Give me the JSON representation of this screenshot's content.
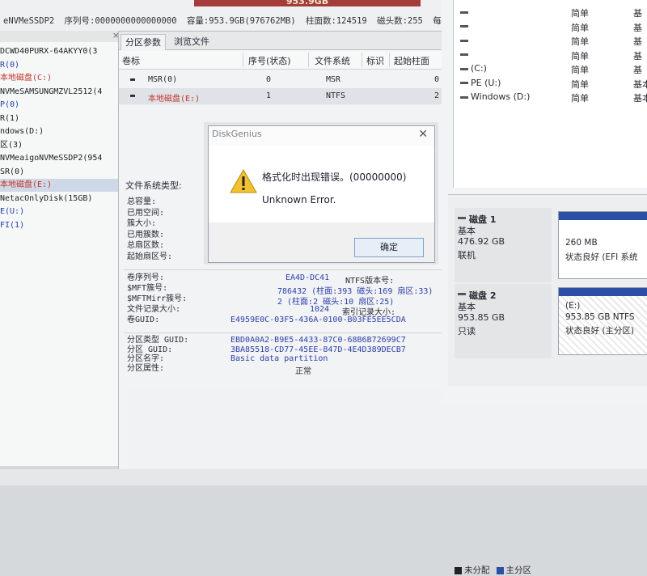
{
  "topbar": {
    "capacity_bar_text": "953.9GB",
    "disk_info": {
      "model": "eNVMeSSDP2",
      "serial_label": "序列号:",
      "serial_value": "0000000000000000",
      "capacity_label": "容量:",
      "capacity_value": "953.9GB(976762MB)",
      "cylinders_label": "柱面数:",
      "cylinders_value": "124519",
      "heads_label": "磁头数:",
      "heads_value": "255",
      "sectors_label": "每"
    }
  },
  "tree": {
    "close_glyph": "×",
    "items": [
      {
        "text": "DCWD40PURX-64AKYY0(3",
        "color": "#1d1d1d"
      },
      {
        "text": "R(0)",
        "color": "#1f3fb5"
      },
      {
        "text": "本地磁盘(C:)",
        "color": "#c2362b"
      },
      {
        "text": "NVMeSAMSUNGMZVL2512(4",
        "color": "#1d1d1d"
      },
      {
        "text": "P(0)",
        "color": "#1f3fb5"
      },
      {
        "text": "R(1)",
        "color": "#1d1d1d"
      },
      {
        "text": "ndows(D:)",
        "color": "#1d1d1d"
      },
      {
        "text": "区(3)",
        "color": "#1d1d1d"
      },
      {
        "text": "NVMeaigoNVMeSSDP2(954",
        "color": "#1d1d1d"
      },
      {
        "text": "SR(0)",
        "color": "#1d1d1d"
      },
      {
        "text": "本地磁盘(E:)",
        "color": "#c2362b"
      },
      {
        "text": "NetacOnlyDisk(15GB)",
        "color": "#1d1d1d"
      },
      {
        "text": "E(U:)",
        "color": "#1f3fb5"
      },
      {
        "text": "FI(1)",
        "color": "#1f3fb5"
      }
    ]
  },
  "mid": {
    "tabs": [
      "分区参数",
      "浏览文件"
    ],
    "columns": [
      "卷标",
      "序号(状态)",
      "文件系统",
      "标识",
      "起始柱面"
    ],
    "rows": [
      {
        "label": "MSR(0)",
        "index": "0",
        "fs": "MSR",
        "id": "",
        "start": "0"
      },
      {
        "label": "本地磁盘(E:)",
        "index": "1",
        "fs": "NTFS",
        "id": "",
        "start": "2"
      }
    ],
    "fs_title": "文件系统类型:",
    "fs_labels": [
      "总容量:",
      "已用空间:",
      "簇大小:",
      "已用簇数:",
      "总扇区数:",
      "起始扇区号:"
    ],
    "fs2_labels": [
      "卷序列号:",
      "$MFT簇号:",
      "$MFTMirr簇号:",
      "文件记录大小:",
      "卷GUID:"
    ],
    "fs2_values": [
      "EA4D-DC41",
      "786432 (柱面:393 磁头:169 扇区:33)",
      "2 (柱面:2 磁头:10 扇区:25)",
      "1024",
      "E4959E0C-03F5-436A-0100-B03FE5EE5CDA"
    ],
    "fs2_side": [
      "NTFS版本号:",
      "",
      "",
      "索引记录大小:",
      ""
    ],
    "part_labels": [
      "分区类型 GUID:",
      "分区 GUID:",
      "分区名字:",
      "分区属性:"
    ],
    "part_values": [
      "EBD0A0A2-B9E5-4433-87C0-68B6B72699C7",
      "3BA85518-CD77-45EE-847D-4E4D389DECB7",
      "Basic data partition",
      "正常"
    ]
  },
  "dialog": {
    "title": "DiskGenius",
    "close_glyph": "✕",
    "message": "格式化时出现错误。(00000000)",
    "detail": "Unknown Error.",
    "ok_label": "确定",
    "warning_icon": "warning-triangle-icon"
  },
  "right": {
    "list": [
      {
        "name": "",
        "type": "简单",
        "state": "基"
      },
      {
        "name": "",
        "type": "简单",
        "state": "基"
      },
      {
        "name": "",
        "type": "简单",
        "state": "基"
      },
      {
        "name": "",
        "type": "简单",
        "state": "基"
      },
      {
        "name": "(C:)",
        "type": "简单",
        "state": "基"
      },
      {
        "name": "PE (U:)",
        "type": "简单",
        "state": "基本"
      },
      {
        "name": "Windows (D:)",
        "type": "简单",
        "state": "基本"
      }
    ],
    "disks": [
      {
        "name": "磁盘 1",
        "type": "基本",
        "size": "476.92 GB",
        "state": "联机",
        "part_name": "",
        "part_size": "260 MB",
        "part_status": "状态良好 (EFI 系统"
      },
      {
        "name": "磁盘 2",
        "type": "基本",
        "size": "953.85 GB",
        "state": "只读",
        "part_name": "(E:)",
        "part_size": "953.85 GB NTFS",
        "part_status": "状态良好 (主分区)"
      }
    ],
    "legend": [
      {
        "label": "未分配",
        "color": "#222222"
      },
      {
        "label": "主分区",
        "color": "#2b4fa5"
      }
    ]
  }
}
